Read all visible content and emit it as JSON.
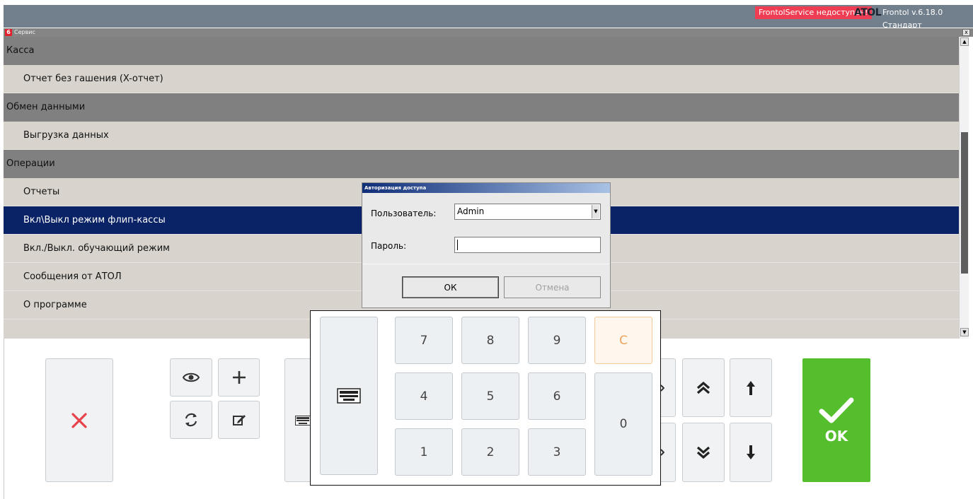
{
  "topbar": {
    "service_status": "FrontolService недоступен!",
    "brand": "ATOL",
    "version": "Frontol v.6.18.0 Стандарт"
  },
  "window": {
    "number": "6",
    "title": "Сервис",
    "close": "x"
  },
  "menu": {
    "rows": [
      {
        "label": "Касса",
        "kind": "category"
      },
      {
        "label": "Отчет без гашения (X-отчет)",
        "kind": "item"
      },
      {
        "label": "Обмен данными",
        "kind": "category"
      },
      {
        "label": "Выгрузка данных",
        "kind": "item"
      },
      {
        "label": "Операции",
        "kind": "category"
      },
      {
        "label": "Отчеты",
        "kind": "item"
      },
      {
        "label": "Вкл\\Выкл режим флип-кассы",
        "kind": "item",
        "selected": true
      },
      {
        "label": "Вкл./Выкл. обучающий режим",
        "kind": "item"
      },
      {
        "label": "Сообщения от АТОЛ",
        "kind": "item"
      },
      {
        "label": "О программе",
        "kind": "item"
      }
    ]
  },
  "dialog": {
    "title": "Авторизация доступа",
    "user_label": "Пользователь:",
    "user_value": "Admin",
    "password_label": "Пароль:",
    "password_value": "",
    "ok_label": "ОК",
    "cancel_label": "Отмена"
  },
  "numpad": {
    "keys": {
      "k7": "7",
      "k8": "8",
      "k9": "9",
      "clear": "C",
      "k4": "4",
      "k5": "5",
      "k6": "6",
      "k0": "0",
      "k1": "1",
      "k2": "2",
      "k3": "3"
    }
  },
  "toolbar": {
    "ok_label": "OK"
  },
  "colors": {
    "topbar": "#72808e",
    "status_badge": "#ef3d53",
    "selected_row": "#0a2266",
    "ok_green": "#55be2c",
    "cancel_red": "#e8434d",
    "clear_key": "#f0a35a"
  },
  "icons": [
    "close-icon",
    "eye-icon",
    "plus-icon",
    "refresh-icon",
    "edit-icon",
    "keyboard-icon",
    "chevron-right-icon",
    "double-chevron-up-icon",
    "double-chevron-down-icon",
    "arrow-up-icon",
    "arrow-down-icon",
    "checkmark-icon",
    "dropdown-arrow-icon",
    "scroll-up-icon",
    "scroll-down-icon"
  ]
}
